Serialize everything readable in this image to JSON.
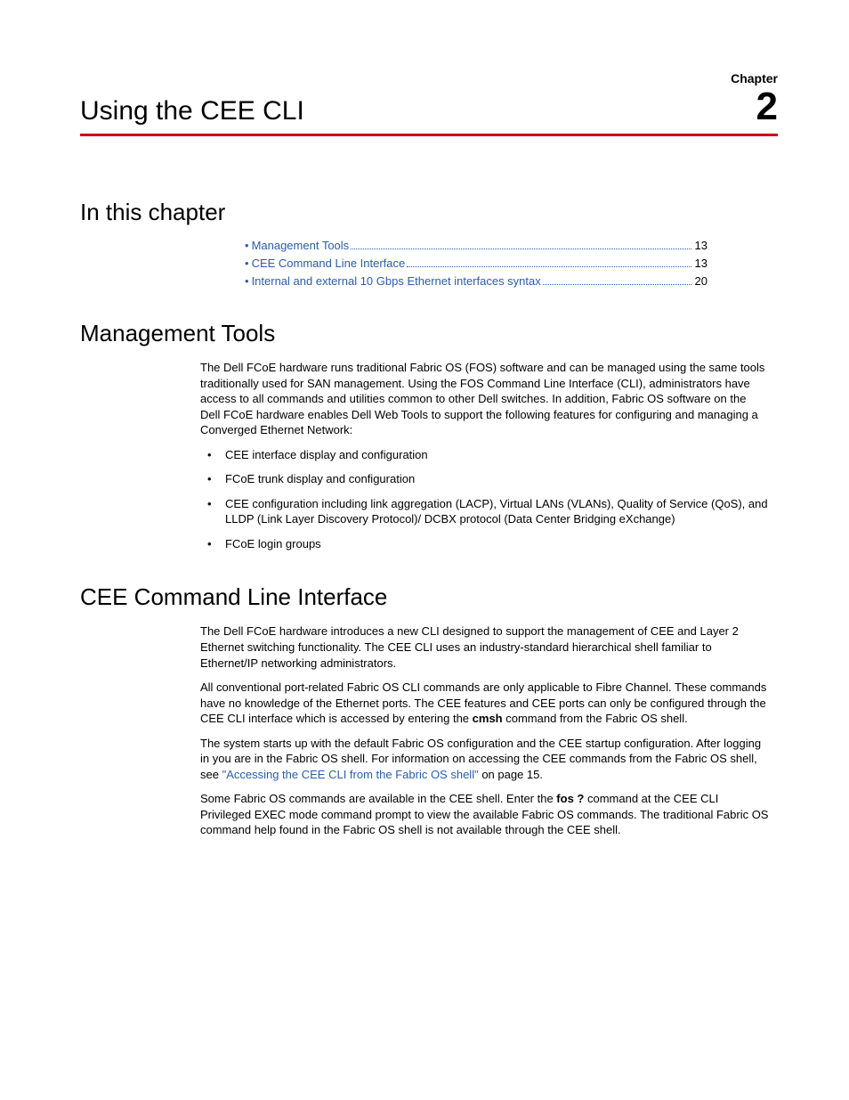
{
  "header": {
    "chapter_label": "Chapter",
    "chapter_title": "Using the CEE CLI",
    "chapter_number": "2"
  },
  "sections": {
    "in_this_chapter": "In this chapter",
    "management_tools": "Management Tools",
    "cee_cli": "CEE Command Line Interface"
  },
  "toc": [
    {
      "label": "Management Tools",
      "page": "13"
    },
    {
      "label": "CEE Command Line Interface",
      "page": "13"
    },
    {
      "label": "Internal and external 10 Gbps Ethernet interfaces syntax",
      "page": "20"
    }
  ],
  "mgmt": {
    "p1": "The Dell FCoE hardware runs traditional Fabric OS (FOS) software and can be managed using the same tools traditionally used for SAN management. Using the FOS Command Line Interface (CLI), administrators have access to all commands and utilities common to other Dell switches. In addition, Fabric OS software on the Dell FCoE hardware enables Dell Web Tools to support the following features for configuring and managing a Converged Ethernet Network:",
    "b1": "CEE interface display and configuration",
    "b2": "FCoE trunk display and configuration",
    "b3": "CEE configuration including link aggregation (LACP), Virtual LANs (VLANs), Quality of Service (QoS), and LLDP (Link Layer Discovery Protocol)/ DCBX protocol (Data Center Bridging eXchange)",
    "b4": "FCoE login groups"
  },
  "cli": {
    "p1": "The Dell FCoE hardware introduces a new CLI designed to support the management of CEE and Layer 2 Ethernet switching functionality. The CEE CLI uses an industry-standard hierarchical shell familiar to Ethernet/IP networking administrators.",
    "p2a": "All conventional port-related Fabric OS CLI commands are only applicable to Fibre Channel. These commands have no knowledge of the Ethernet ports. The CEE features and CEE ports can only be configured through the CEE CLI interface which is accessed by entering the ",
    "p2_cmd": "cmsh",
    "p2b": " command from the Fabric OS shell.",
    "p3a": "The system starts up with the default Fabric OS configuration and the CEE startup configuration. After logging in you are in the Fabric OS shell. For information on accessing the CEE commands from the Fabric OS shell, see ",
    "p3_link": "\"Accessing the CEE CLI from the Fabric OS shell\"",
    "p3b": " on page 15.",
    "p4a": "Some Fabric OS commands are available in the CEE shell. Enter the ",
    "p4_cmd": "fos ?",
    "p4b": " command at the CEE CLI Privileged EXEC mode command prompt to view the available Fabric OS commands. The traditional Fabric OS command help found in the Fabric OS shell is not available through the CEE shell."
  }
}
